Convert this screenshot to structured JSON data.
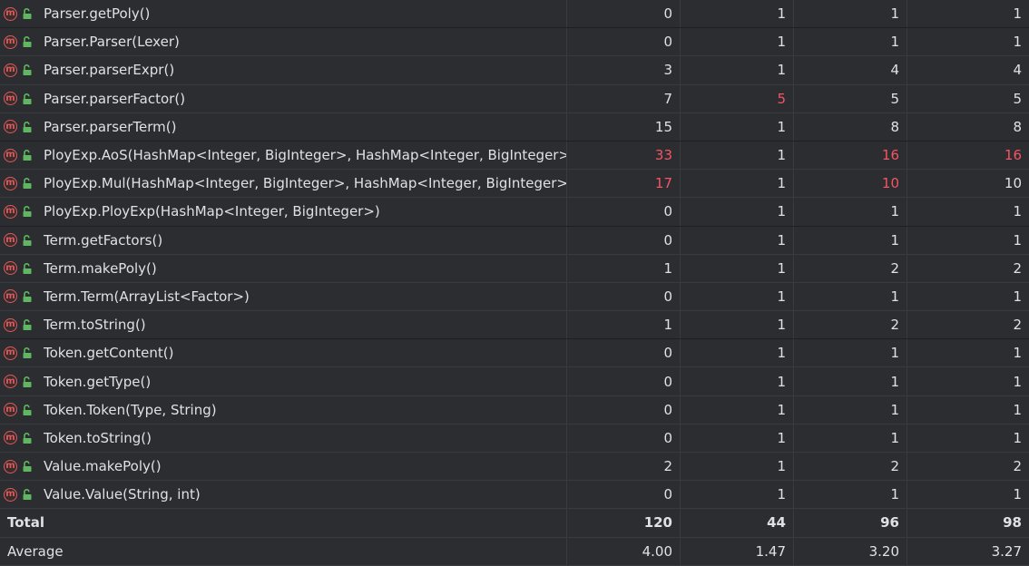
{
  "colors": {
    "background": "#2b2d30",
    "grid": "#393b40",
    "text": "#dfe1e5",
    "hot": "#f75464",
    "method_icon": "#db5c5c",
    "lock_icon": "#5fb85f"
  },
  "icons": {
    "method": "method-m-icon",
    "visibility": "public-lock-icon",
    "method_letter": "m"
  },
  "rows": [
    {
      "name": "Parser.getPoly()",
      "values": [
        "0",
        "1",
        "1",
        "1"
      ],
      "hot": [
        false,
        false,
        false,
        false
      ]
    },
    {
      "name": "Parser.Parser(Lexer)",
      "values": [
        "0",
        "1",
        "1",
        "1"
      ],
      "hot": [
        false,
        false,
        false,
        false
      ]
    },
    {
      "name": "Parser.parserExpr()",
      "values": [
        "3",
        "1",
        "4",
        "4"
      ],
      "hot": [
        false,
        false,
        false,
        false
      ]
    },
    {
      "name": "Parser.parserFactor()",
      "values": [
        "7",
        "5",
        "5",
        "5"
      ],
      "hot": [
        false,
        true,
        false,
        false
      ]
    },
    {
      "name": "Parser.parserTerm()",
      "values": [
        "15",
        "1",
        "8",
        "8"
      ],
      "hot": [
        false,
        false,
        false,
        false
      ]
    },
    {
      "name": "PloyExp.AoS(HashMap<Integer, BigInteger>, HashMap<Integer, BigInteger>)",
      "values": [
        "33",
        "1",
        "16",
        "16"
      ],
      "hot": [
        true,
        false,
        true,
        true
      ]
    },
    {
      "name": "PloyExp.Mul(HashMap<Integer, BigInteger>, HashMap<Integer, BigInteger>)",
      "values": [
        "17",
        "1",
        "10",
        "10"
      ],
      "hot": [
        true,
        false,
        true,
        false
      ]
    },
    {
      "name": "PloyExp.PloyExp(HashMap<Integer, BigInteger>)",
      "values": [
        "0",
        "1",
        "1",
        "1"
      ],
      "hot": [
        false,
        false,
        false,
        false
      ]
    },
    {
      "name": "Term.getFactors()",
      "values": [
        "0",
        "1",
        "1",
        "1"
      ],
      "hot": [
        false,
        false,
        false,
        false
      ]
    },
    {
      "name": "Term.makePoly()",
      "values": [
        "1",
        "1",
        "2",
        "2"
      ],
      "hot": [
        false,
        false,
        false,
        false
      ]
    },
    {
      "name": "Term.Term(ArrayList<Factor>)",
      "values": [
        "0",
        "1",
        "1",
        "1"
      ],
      "hot": [
        false,
        false,
        false,
        false
      ]
    },
    {
      "name": "Term.toString()",
      "values": [
        "1",
        "1",
        "2",
        "2"
      ],
      "hot": [
        false,
        false,
        false,
        false
      ]
    },
    {
      "name": "Token.getContent()",
      "values": [
        "0",
        "1",
        "1",
        "1"
      ],
      "hot": [
        false,
        false,
        false,
        false
      ]
    },
    {
      "name": "Token.getType()",
      "values": [
        "0",
        "1",
        "1",
        "1"
      ],
      "hot": [
        false,
        false,
        false,
        false
      ]
    },
    {
      "name": "Token.Token(Type, String)",
      "values": [
        "0",
        "1",
        "1",
        "1"
      ],
      "hot": [
        false,
        false,
        false,
        false
      ]
    },
    {
      "name": "Token.toString()",
      "values": [
        "0",
        "1",
        "1",
        "1"
      ],
      "hot": [
        false,
        false,
        false,
        false
      ]
    },
    {
      "name": "Value.makePoly()",
      "values": [
        "2",
        "1",
        "2",
        "2"
      ],
      "hot": [
        false,
        false,
        false,
        false
      ]
    },
    {
      "name": "Value.Value(String, int)",
      "values": [
        "0",
        "1",
        "1",
        "1"
      ],
      "hot": [
        false,
        false,
        false,
        false
      ]
    }
  ],
  "total": {
    "label": "Total",
    "values": [
      "120",
      "44",
      "96",
      "98"
    ]
  },
  "average": {
    "label": "Average",
    "values": [
      "4.00",
      "1.47",
      "3.20",
      "3.27"
    ]
  }
}
